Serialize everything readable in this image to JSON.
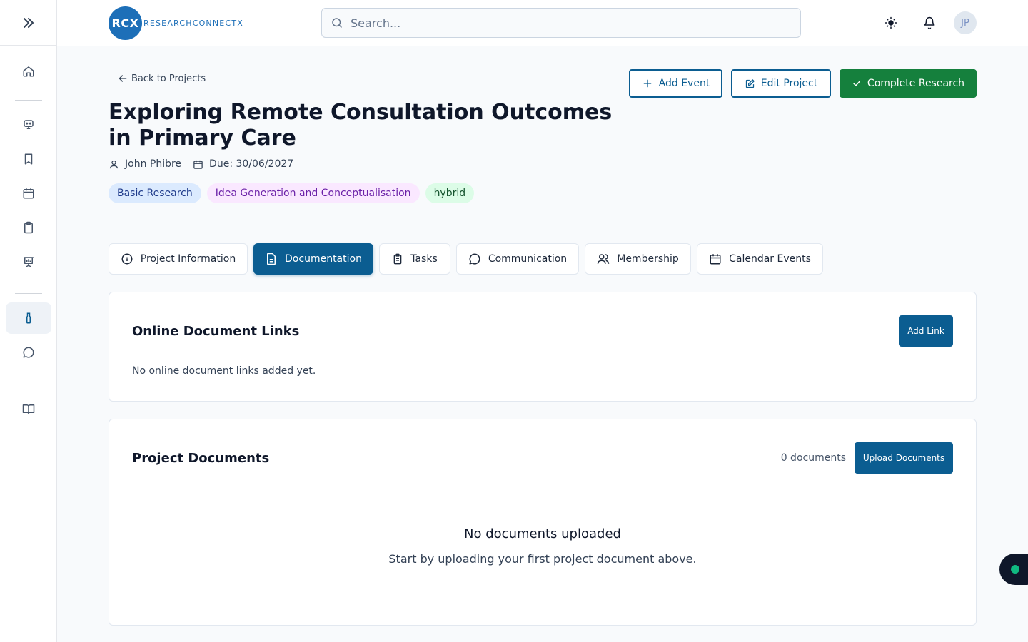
{
  "header": {
    "logo_mark": "RCX",
    "logo_text": "RESEARCHCONNECTX",
    "search_placeholder": "Search...",
    "avatar_initials": "JP"
  },
  "page": {
    "back_label": "Back to Projects",
    "title": "Exploring Remote Consultation Outcomes in Primary Care",
    "owner": "John Phibre",
    "due": "Due: 30/06/2027",
    "tags": [
      {
        "label": "Basic Research",
        "bg": "#dbeafe",
        "fg": "#1e3a8a"
      },
      {
        "label": "Idea Generation and Conceptualisation",
        "bg": "#fae8ff",
        "fg": "#6b21a8"
      },
      {
        "label": "hybrid",
        "bg": "#dcfce7",
        "fg": "#14532d"
      }
    ]
  },
  "actions": {
    "add_event": "Add Event",
    "edit_project": "Edit Project",
    "complete_research": "Complete Research"
  },
  "tabs": [
    {
      "label": "Project Information"
    },
    {
      "label": "Documentation"
    },
    {
      "label": "Tasks"
    },
    {
      "label": "Communication"
    },
    {
      "label": "Membership"
    },
    {
      "label": "Calendar Events"
    }
  ],
  "links_card": {
    "title": "Online Document Links",
    "add_label": "Add Link",
    "empty": "No online document links added yet."
  },
  "docs_card": {
    "title": "Project Documents",
    "count": "0 documents",
    "upload_label": "Upload Documents",
    "empty_title": "No documents uploaded",
    "empty_sub": "Start by uploading your first project document above."
  },
  "colors": {
    "primary": "#0b5d91",
    "success": "#15803d"
  }
}
